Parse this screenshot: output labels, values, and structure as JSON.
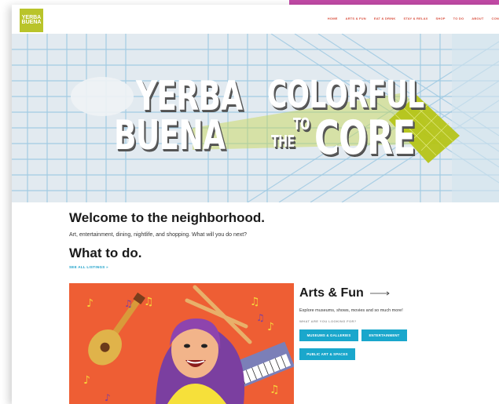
{
  "header": {
    "logo_line1": "YERBA",
    "logo_line2": "BUENA",
    "nav": [
      "HOME",
      "ARTS & FUN",
      "EAT & DRINK",
      "STAY & RELAX",
      "SHOP",
      "TO DO",
      "ABOUT",
      "CON"
    ]
  },
  "hero": {
    "word1": "YERBA",
    "word2": "BUENA",
    "word3": "COLORFUL",
    "word4": "TO",
    "word5": "THE",
    "word6": "CORE"
  },
  "welcome": {
    "title": "Welcome to the neighborhood.",
    "subtitle": "Art, entertainment, dining, nightlife, and shopping. What will you do next?"
  },
  "todo": {
    "title": "What to do.",
    "see_all": "SEE ALL LISTINGS »"
  },
  "arts": {
    "title": "Arts & Fun",
    "description": "Explore museums, shows, movies and so much more!",
    "looking_for": "WHAT ARE YOU LOOKING FOR?",
    "buttons": {
      "museums": "MUSEUMS & GALLERIES",
      "entertainment": "ENTERTAINMENT",
      "public_art": "PUBLIC ART & SPACES"
    }
  },
  "colors": {
    "accent_blue": "#1aa7cc",
    "nav_red": "#d9503f",
    "logo_green": "#b9c42a",
    "illustration_orange": "#ee5e34"
  }
}
